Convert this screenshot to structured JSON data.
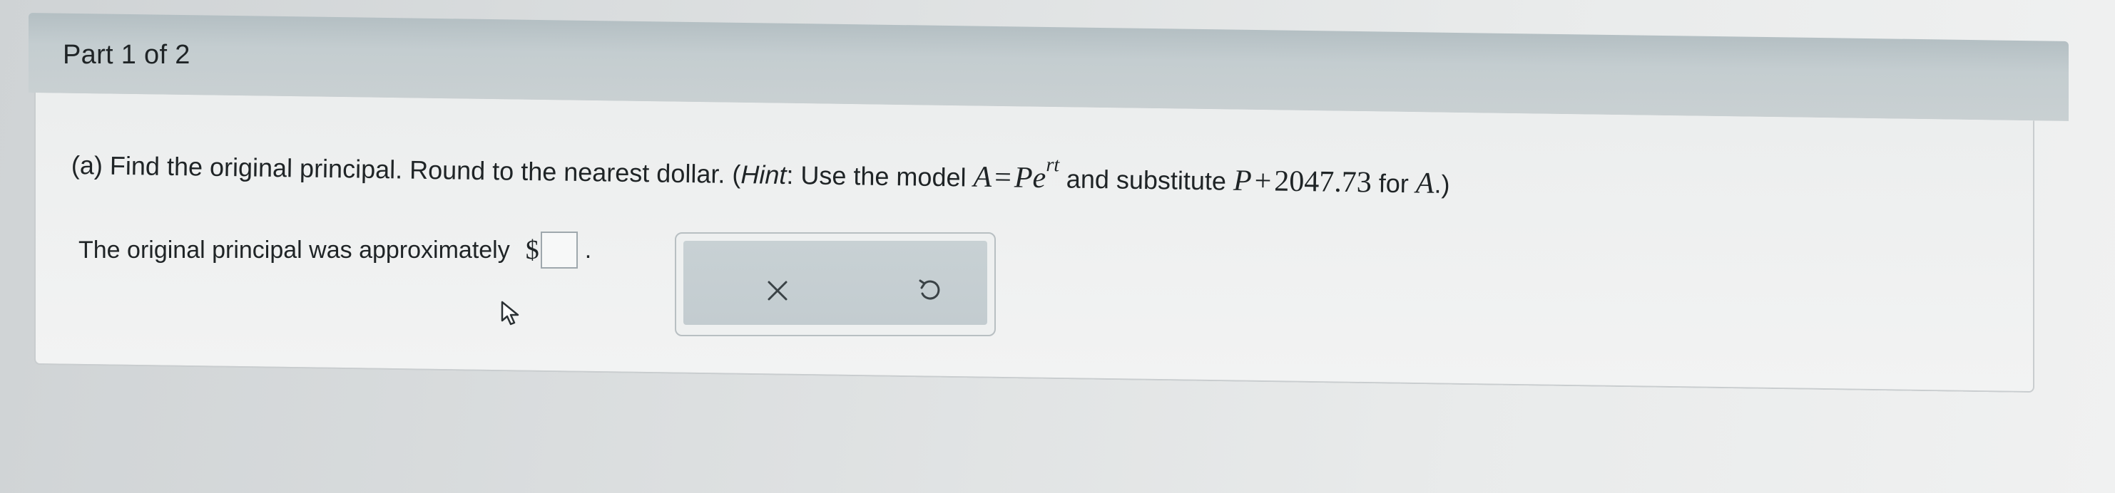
{
  "part": {
    "label": "Part 1 of 2"
  },
  "question": {
    "prefix": "(a) Find the original principal. Round to the nearest dollar. (",
    "hint_word": "Hint",
    "hint_text": ": Use the model ",
    "model_A": "A",
    "model_equals": "=",
    "model_P": "P",
    "model_e": "e",
    "model_exp": "rt",
    "substitute_text": " and substitute ",
    "sub_P": "P",
    "sub_plus": "+",
    "sub_value": "2047.73",
    "for_text": " for ",
    "for_A": "A",
    "suffix": ".)"
  },
  "answer": {
    "label": "The original principal was approximately",
    "currency": "$",
    "value": "",
    "period": "."
  },
  "actions": {
    "clear_icon": "close-icon",
    "retry_icon": "undo-icon"
  },
  "colors": {
    "header_bg": "#c4cdd0",
    "card_bg": "#f0f1f1",
    "action_bg": "#c5ced1",
    "text": "#1f2426"
  }
}
